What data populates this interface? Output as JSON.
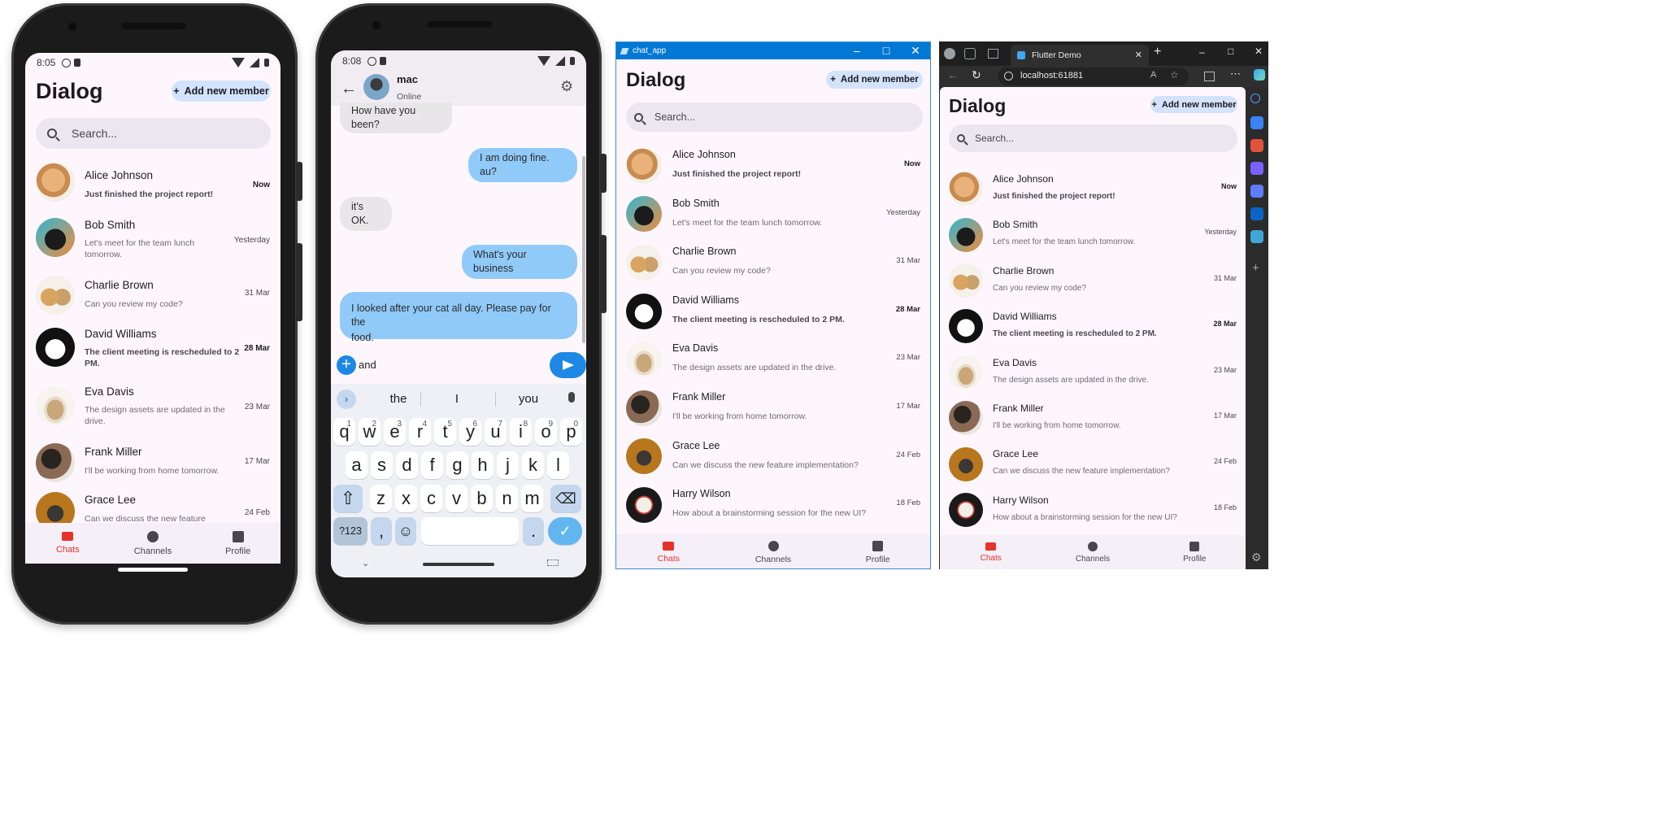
{
  "colors": {
    "accent_red": "#e5322d",
    "bubble_out": "#90caf9",
    "bubble_in": "#e9e6ea",
    "add_btn": "#d3e3fb",
    "search_bg": "#ece6f0",
    "win_blue": "#0078d4"
  },
  "dialog": {
    "title": "Dialog",
    "add_member_label": "Add new member",
    "search_placeholder": "Search...",
    "chats": [
      {
        "name": "Alice Johnson",
        "message": "Just finished the project report!",
        "time": "Now",
        "unread": true,
        "avatar": "orange-cat-avatar"
      },
      {
        "name": "Bob Smith",
        "message": "Let's meet for the team lunch tomorrow.",
        "time": "Yesterday",
        "unread": false,
        "avatar": "tuxedo-cat-avatar"
      },
      {
        "name": "Charlie Brown",
        "message": "Can you review my code?",
        "time": "31 Mar",
        "unread": false,
        "avatar": "dog-and-cat-avatar"
      },
      {
        "name": "David Williams",
        "message": "The client meeting is rescheduled to 2 PM.",
        "time": "28 Mar",
        "unread": true,
        "avatar": "cartoon-cat-avatar"
      },
      {
        "name": "Eva Davis",
        "message": "The design assets are updated in the drive.",
        "time": "23 Mar",
        "unread": false,
        "avatar": "box-cat-avatar"
      },
      {
        "name": "Frank Miller",
        "message": "I'll be working from home tomorrow.",
        "time": "17 Mar",
        "unread": false,
        "avatar": "hat-cat-avatar"
      },
      {
        "name": "Grace Lee",
        "message": "Can we discuss the new feature implementation?",
        "time": "24 Feb",
        "unread": false,
        "avatar": "black-cat-avatar"
      },
      {
        "name": "Harry Wilson",
        "message": "How about a brainstorming session for the new UI?",
        "time": "18 Feb",
        "unread": false,
        "avatar": "can-avatar"
      }
    ],
    "phone1_chats": {
      "bob_msg_l1": "Let's meet for the team lunch",
      "bob_msg_l2": "tomorrow.",
      "david_msg_l1": "The client meeting is rescheduled to 2",
      "david_msg_l2": "PM.",
      "eva_msg_l1": "The design assets are updated in the",
      "eva_msg_l2": "drive.",
      "grace_msg_l1": "Can we discuss the new feature"
    },
    "nav": [
      {
        "label": "Chats",
        "icon": "chat-icon",
        "active": true
      },
      {
        "label": "Channels",
        "icon": "channels-icon",
        "active": false
      },
      {
        "label": "Profile",
        "icon": "profile-icon",
        "active": false
      }
    ]
  },
  "phone1": {
    "time": "8:05"
  },
  "phone2": {
    "time": "8:08",
    "contact_name": "mac",
    "contact_status": "Online",
    "messages": [
      {
        "text": "How have you been?",
        "out": false
      },
      {
        "text": "I am doing fine. au?",
        "out": true
      },
      {
        "text": "it's OK.",
        "out": false
      },
      {
        "text": "What's your business",
        "out": true
      },
      {
        "text_l1": "I looked after your cat all day. Please pay for the",
        "text_l2": "food.",
        "out": true
      }
    ],
    "input_value": "and",
    "suggestions": [
      "the",
      "I",
      "you"
    ],
    "keyboard": {
      "row1": [
        [
          "q",
          "1"
        ],
        [
          "w",
          "2"
        ],
        [
          "e",
          "3"
        ],
        [
          "r",
          "4"
        ],
        [
          "t",
          "5"
        ],
        [
          "y",
          "6"
        ],
        [
          "u",
          "7"
        ],
        [
          "i",
          "8"
        ],
        [
          "o",
          "9"
        ],
        [
          "p",
          "0"
        ]
      ],
      "row2": [
        "a",
        "s",
        "d",
        "f",
        "g",
        "h",
        "j",
        "k",
        "l"
      ],
      "row3": [
        "z",
        "x",
        "c",
        "v",
        "b",
        "n",
        "m"
      ],
      "sym_label": "?123",
      "comma": ",",
      "period": "."
    }
  },
  "window1": {
    "title": "chat_app"
  },
  "window2": {
    "tab_title": "Flutter Demo",
    "address": "localhost:61881"
  }
}
